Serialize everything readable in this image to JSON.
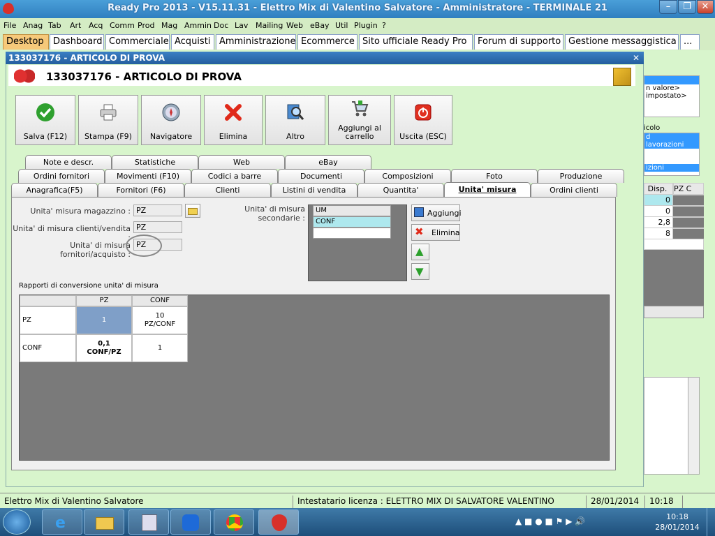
{
  "window": {
    "title": "Ready Pro 2013 - V15.11.31 - Elettro Mix di Valentino Salvatore - Amministratore - TERMINALE 21"
  },
  "menu": [
    "File",
    "Anag",
    "Tab",
    "Art",
    "Acq",
    "Comm",
    "Prod",
    "Mag",
    "Ammin",
    "Doc",
    "Lav",
    "Mailing",
    "Web",
    "eBay",
    "Util",
    "Plugin",
    "?"
  ],
  "desktop_tabs": [
    "Desktop",
    "Dashboard",
    "Commerciale",
    "Acquisti",
    "Amministrazione",
    "Ecommerce",
    "Sito ufficiale Ready Pro",
    "Forum di supporto",
    "Gestione messaggistica",
    "..."
  ],
  "doc": {
    "outer_title": "133037176 - ARTICOLO DI PROVA",
    "inner_title": "133037176 - ARTICOLO DI PROVA"
  },
  "toolbar": {
    "save": "Salva (F12)",
    "print": "Stampa (F9)",
    "nav": "Navigatore",
    "delete": "Elimina",
    "other": "Altro",
    "cart_1": "Aggiungi al",
    "cart_2": "carrello",
    "exit": "Uscita (ESC)"
  },
  "tabs_row1": [
    "Note e descr.",
    "Statistiche",
    "Web",
    "eBay"
  ],
  "tabs_row2": [
    "Ordini fornitori",
    "Movimenti (F10)",
    "Codici a barre",
    "Documenti",
    "Composizioni",
    "Foto",
    "Produzione"
  ],
  "tabs_row3": [
    "Anagrafica(F5)",
    "Fornitori (F6)",
    "Clienti",
    "Listini di vendita",
    "Quantita'",
    "Unita' misura",
    "Ordini clienti"
  ],
  "um": {
    "warehouse_label": "Unita' misura magazzino :",
    "warehouse_value": "PZ",
    "clients_label": "Unita' di misura clienti/vendita :",
    "clients_value": "PZ",
    "suppliers_label": "Unita' di misura fornitori/acquisto :",
    "suppliers_value": "PZ",
    "secondary_label": "Unita' di misura secondarie :",
    "secondary_header": "UM",
    "secondary_items": [
      "CONF"
    ],
    "add": "Aggiungi",
    "remove": "Elimina",
    "conv_title": "Rapporti di conversione unita' di misura",
    "grid": {
      "col1": "PZ",
      "col2": "CONF",
      "row1": "PZ",
      "r1c1": "1",
      "r1c2_a": "10",
      "r1c2_b": "PZ/CONF",
      "row2": "CONF",
      "r2c1_a": "0,1",
      "r2c1_b": "CONF/PZ",
      "r2c2": "1"
    }
  },
  "right": {
    "item1": "n valore>",
    "item2": "impostato>",
    "sec_label": "icolo",
    "li1": "d",
    "li2": "lavorazioni",
    "li3": "izioni",
    "hdr1": "Disp.",
    "hdr2": "PZ C",
    "vals": [
      "0",
      "0",
      "2,8",
      "8"
    ]
  },
  "status": {
    "company": "Elettro Mix di Valentino Salvatore",
    "license": "Intestatario licenza : ELETTRO MIX DI SALVATORE VALENTINO",
    "date": "28/01/2014",
    "time": "10:18"
  },
  "taskbar": {
    "time": "10:18",
    "date": "28/01/2014"
  },
  "colors": {
    "accent": "#2f7fc0",
    "bg": "#d8f5cc",
    "active_tab": "#f6c97a"
  }
}
